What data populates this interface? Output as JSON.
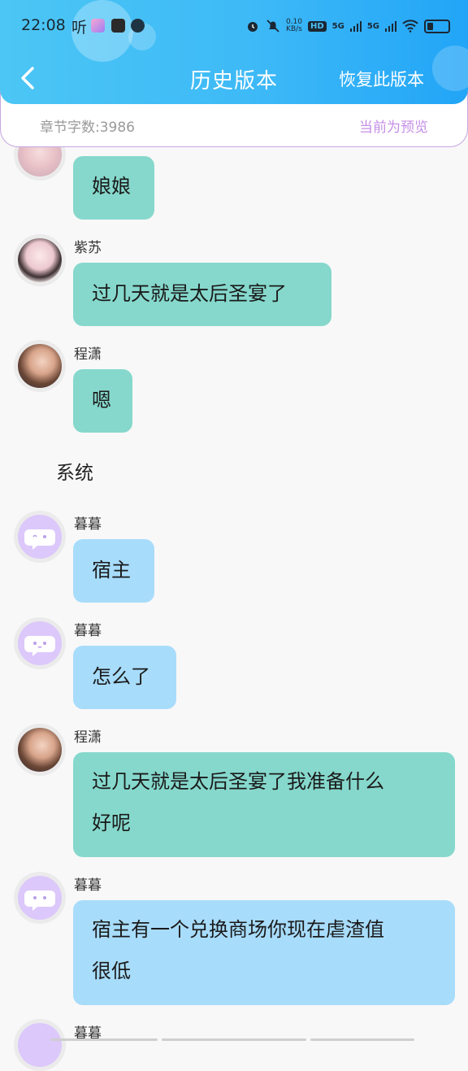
{
  "statusbar": {
    "time": "22:08",
    "ting": "听",
    "net_speed_top": "0.10",
    "net_speed_bottom": "KB/s",
    "hd_label": "HD",
    "sig1_label": "5G",
    "sig2_label": "5G"
  },
  "header": {
    "title": "历史版本",
    "restore_label": "恢复此版本"
  },
  "info": {
    "word_count": "章节字数:3986",
    "preview_label": "当前为预览"
  },
  "chat": {
    "m0": {
      "text": "娘娘"
    },
    "m1": {
      "name": "紫苏",
      "text": "过几天就是太后圣宴了"
    },
    "m2": {
      "name": "程潇",
      "text": "嗯"
    },
    "system_label": "系统",
    "m3": {
      "name": "暮暮",
      "text": "宿主"
    },
    "m4": {
      "name": "暮暮",
      "text": "怎么了"
    },
    "m5": {
      "name": "程潇",
      "text_line1": "过几天就是太后圣宴了我准备什么",
      "text_line2": "好呢"
    },
    "m6": {
      "name": "暮暮",
      "text_line1": "宿主有一个兑换商场你现在虐渣值",
      "text_line2": "很低"
    },
    "m7": {
      "name": "暮暮"
    }
  },
  "colors": {
    "header_start": "#4cc6f4",
    "header_end": "#22a5f7",
    "bubble_green": "#86d8cc",
    "bubble_blue": "#a8dcfb",
    "preview_purple": "#c58ee8"
  },
  "icons": [
    "back-chevron-icon",
    "alarm-icon",
    "mute-icon",
    "wifi-icon",
    "battery-icon",
    "chat-bubble-icon"
  ]
}
